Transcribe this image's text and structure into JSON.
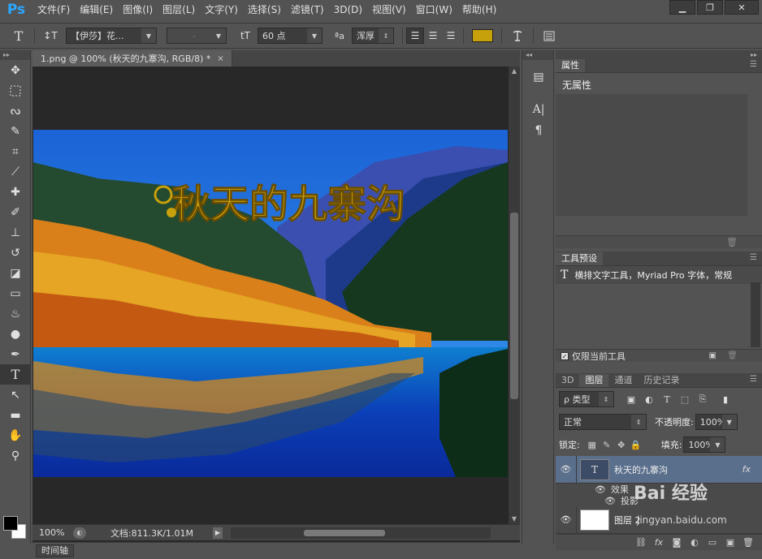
{
  "app": {
    "logo": "Ps"
  },
  "menu": [
    "文件(F)",
    "编辑(E)",
    "图像(I)",
    "图层(L)",
    "文字(Y)",
    "选择(S)",
    "滤镜(T)",
    "3D(D)",
    "视图(V)",
    "窗口(W)",
    "帮助(H)"
  ],
  "window_controls": {
    "minimize": "▁",
    "restore": "❐",
    "close": "✕"
  },
  "options": {
    "tool_icon": "T",
    "orient_icon": "↕T",
    "font_family": "【伊莎】花...",
    "font_style": "-",
    "size_icon": "tT",
    "font_size": "60 点",
    "aa_icon": "ªa",
    "antialias": "浑厚",
    "color": "#c7a10c"
  },
  "document": {
    "tab_title": "1.png @ 100% (秋天的九寨沟, RGB/8) *",
    "tab_close": "×",
    "canvas_text": "秋天的九寨沟",
    "zoom": "100%",
    "doc_info": "文档:811.3K/1.01M"
  },
  "timeline": {
    "label": "时间轴"
  },
  "properties": {
    "tab": "属性",
    "content": "无属性"
  },
  "tool_presets": {
    "tab": "工具预设",
    "item": "横排文字工具，Myriad Pro 字体，常规",
    "current_tool_only": "仅限当前工具"
  },
  "layers": {
    "tabs": [
      "3D",
      "图层",
      "通道",
      "历史记录"
    ],
    "filter_kind": "ρ 类型",
    "blend_mode": "正常",
    "opacity_label": "不透明度:",
    "opacity": "100%",
    "lock_label": "锁定:",
    "fill_label": "填充:",
    "fill": "100%",
    "items": [
      {
        "name": "秋天的九寨沟",
        "fx": "fx",
        "effects_label": "效果",
        "effect": "投影"
      },
      {
        "name": "图层 2"
      }
    ]
  },
  "watermark": {
    "logo": "Bai 经验",
    "site": "jingyan.baidu.com"
  }
}
